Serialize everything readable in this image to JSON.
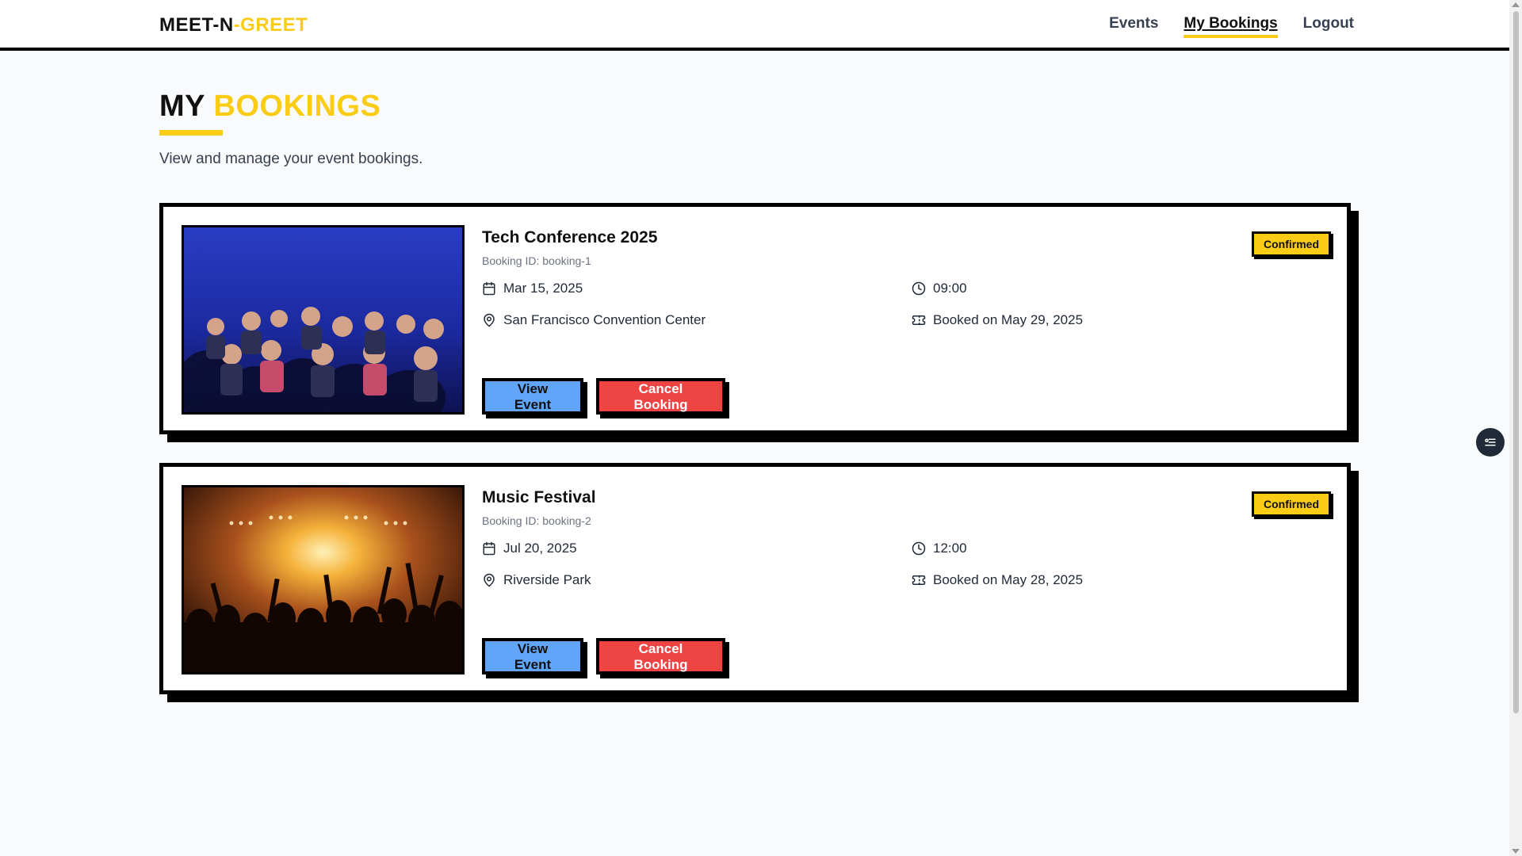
{
  "header": {
    "logo_main": "MEET-N",
    "logo_accent": "-GREET",
    "nav": [
      {
        "label": "Events"
      },
      {
        "label": "My Bookings",
        "active": true
      },
      {
        "label": "Logout"
      }
    ]
  },
  "page": {
    "title_main": "MY",
    "title_accent": "BOOKINGS",
    "subtitle": "View and manage your event bookings."
  },
  "bookings": [
    {
      "title": "Tech Conference 2025",
      "booking_id": "Booking ID: booking-1",
      "date": "Mar 15, 2025",
      "time": "09:00",
      "location": "San Francisco Convention Center",
      "booked_on": "Booked on May 29, 2025",
      "status": "Confirmed",
      "view_label": "View Event",
      "cancel_label": "Cancel Booking"
    },
    {
      "title": "Music Festival",
      "booking_id": "Booking ID: booking-2",
      "date": "Jul 20, 2025",
      "time": "12:00",
      "location": "Riverside Park",
      "booked_on": "Booked on May 28, 2025",
      "status": "Confirmed",
      "view_label": "View Event",
      "cancel_label": "Cancel Booking"
    }
  ],
  "colors": {
    "accent": "#facc15",
    "view_button": "#60a5fa",
    "cancel_button": "#ef4444"
  },
  "icons": [
    "calendar-icon",
    "clock-icon",
    "map-pin-icon",
    "ticket-icon",
    "filter-icon"
  ]
}
